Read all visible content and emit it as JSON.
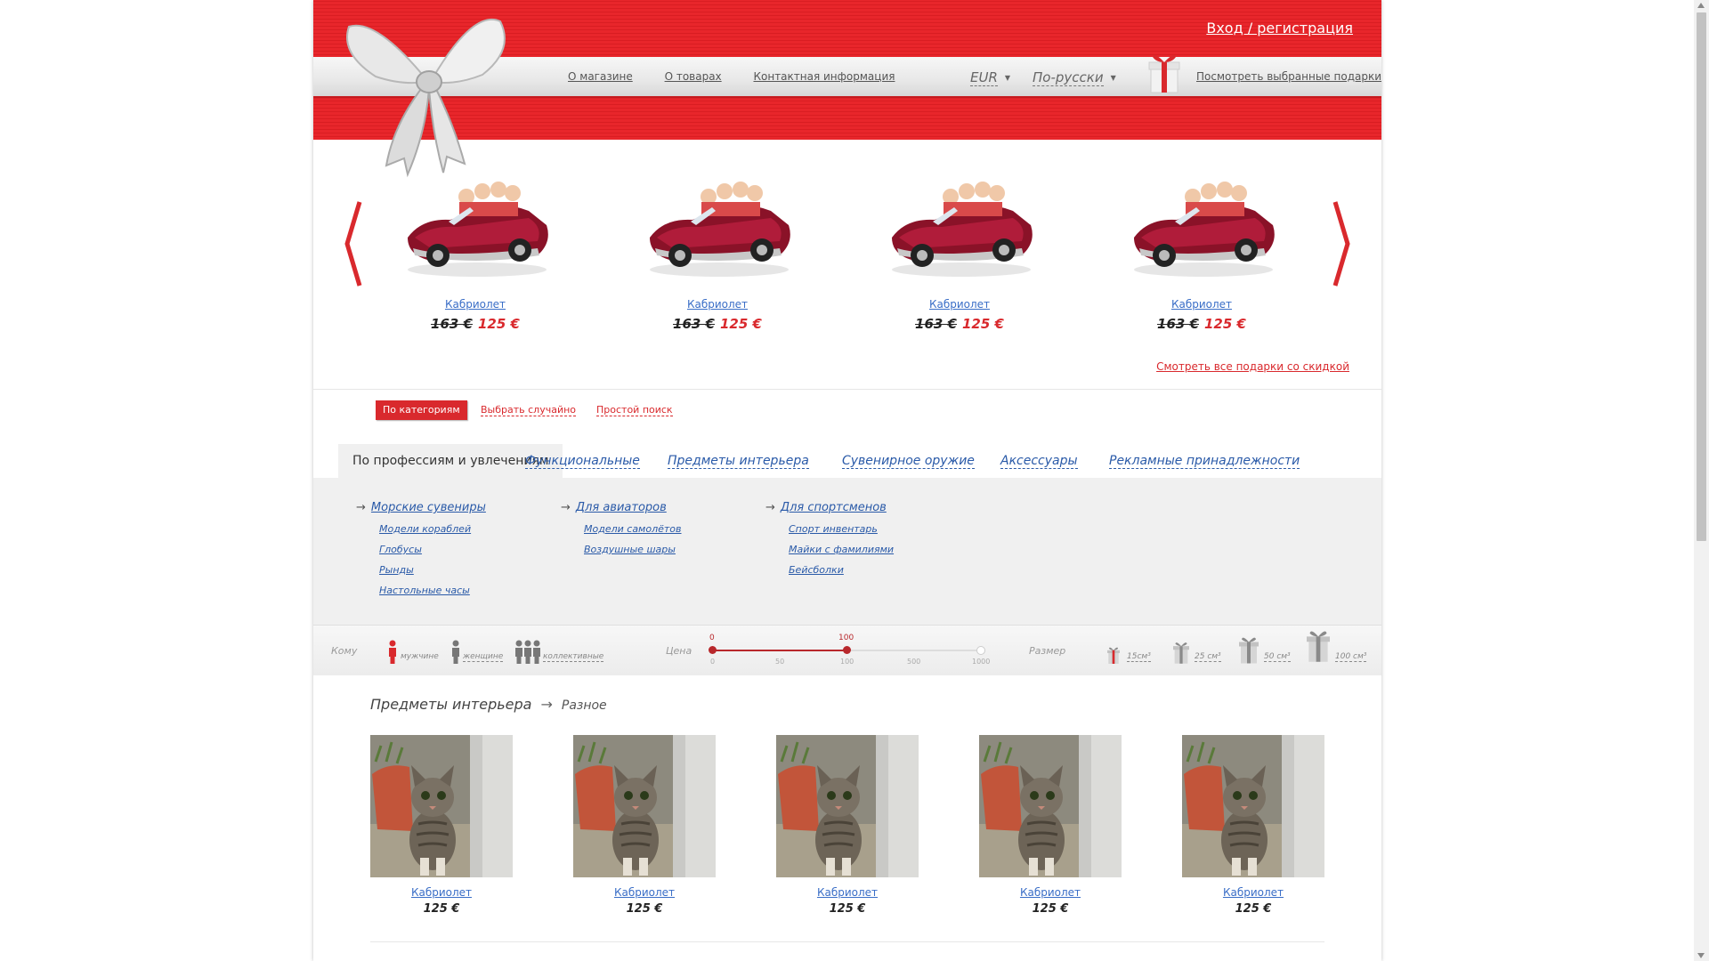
{
  "header": {
    "login": "Вход / регистрация",
    "nav": [
      "О магазине",
      "О товарах",
      "Контактная информация"
    ],
    "currency": "EUR",
    "language": "По-русски",
    "wishlist": "Посмотреть выбранные подарки",
    "brand_color": "#e8262b"
  },
  "carousel": {
    "items": [
      {
        "name": "Кабриолет",
        "old_price": "163 €",
        "new_price": "125 €"
      },
      {
        "name": "Кабриолет",
        "old_price": "163 €",
        "new_price": "125 €"
      },
      {
        "name": "Кабриолет",
        "old_price": "163 €",
        "new_price": "125 €"
      },
      {
        "name": "Кабриолет",
        "old_price": "163 €",
        "new_price": "125 €"
      }
    ],
    "see_all": "Смотреть все подарки со скидкой"
  },
  "search_modes": {
    "active": "По категориям",
    "random": "Выбрать случайно",
    "simple": "Простой поиск"
  },
  "category_tabs": [
    "По профессиям и увлечениям",
    "Функциональные",
    "Предметы интерьера",
    "Сувенирное оружие",
    "Аксессуары",
    "Рекламные принадлежности"
  ],
  "categories": [
    {
      "title": "Морские сувениры",
      "items": [
        "Модели кораблей",
        "Глобусы",
        "Рынды",
        "Настольные часы"
      ]
    },
    {
      "title": "Для авиаторов",
      "items": [
        "Модели самолётов",
        "Воздушные шары"
      ]
    },
    {
      "title": "Для спортсменов",
      "items": [
        "Спорт инвентарь",
        "Майки с фамилиями",
        "Бейсболки"
      ]
    }
  ],
  "filter": {
    "to_label": "Кому",
    "to_options": [
      "мужчине",
      "женщине",
      "коллективные"
    ],
    "price_label": "Цена",
    "price_min": "0",
    "price_max": "100",
    "price_ticks": [
      "0",
      "50",
      "100",
      "500",
      "1000"
    ],
    "price_range_fraction": [
      0,
      0.5
    ],
    "size_label": "Размер",
    "sizes": [
      "15см³",
      "25 см³",
      "50 см³",
      "100 см³"
    ]
  },
  "results": {
    "category": "Предметы интерьера",
    "subcategory": "Разное",
    "items": [
      {
        "name": "Кабриолет",
        "price": "125 €"
      },
      {
        "name": "Кабриолет",
        "price": "125 €"
      },
      {
        "name": "Кабриолет",
        "price": "125 €"
      },
      {
        "name": "Кабриолет",
        "price": "125 €"
      },
      {
        "name": "Кабриолет",
        "price": "125 €"
      }
    ]
  }
}
